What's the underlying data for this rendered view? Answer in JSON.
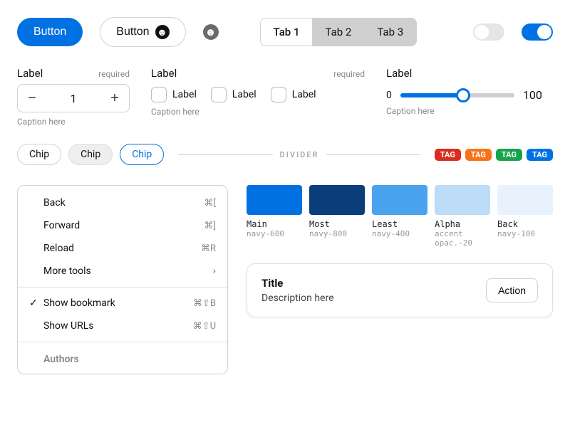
{
  "buttons": {
    "primary": "Button",
    "secondary": "Button"
  },
  "tabs": [
    "Tab 1",
    "Tab 2",
    "Tab 3"
  ],
  "stepper": {
    "label": "Label",
    "required": "required",
    "value": "1",
    "caption": "Caption here"
  },
  "checks": {
    "label": "Label",
    "required": "required",
    "options": [
      "Label",
      "Label",
      "Label"
    ],
    "caption": "Caption here"
  },
  "slider": {
    "label": "Label",
    "min": "0",
    "max": "100",
    "caption": "Caption here"
  },
  "chips": [
    "Chip",
    "Chip",
    "Chip"
  ],
  "divider": "DIVIDER",
  "tags": [
    "TAG",
    "TAG",
    "TAG",
    "TAG"
  ],
  "menu": {
    "items": [
      {
        "label": "Back",
        "shortcut": "⌘["
      },
      {
        "label": "Forward",
        "shortcut": "⌘]"
      },
      {
        "label": "Reload",
        "shortcut": "⌘R"
      },
      {
        "label": "More tools",
        "chevron": true
      }
    ],
    "items2": [
      {
        "label": "Show bookmark",
        "shortcut": "⌘⇧B",
        "checked": true
      },
      {
        "label": "Show URLs",
        "shortcut": "⌘⇧U"
      }
    ],
    "heading": "Authors"
  },
  "palette": [
    {
      "name": "Main",
      "code": "navy-600",
      "color": "#0071e3"
    },
    {
      "name": "Most",
      "code": "navy-800",
      "color": "#0a3d7a"
    },
    {
      "name": "Least",
      "code": "navy-400",
      "color": "#4aa3ef"
    },
    {
      "name": "Alpha",
      "code": "accent opac.-20",
      "color": "#bcdcf7"
    },
    {
      "name": "Back",
      "code": "navy-100",
      "color": "#e8f2fc"
    }
  ],
  "card": {
    "title": "Title",
    "desc": "Description here",
    "action": "Action"
  }
}
